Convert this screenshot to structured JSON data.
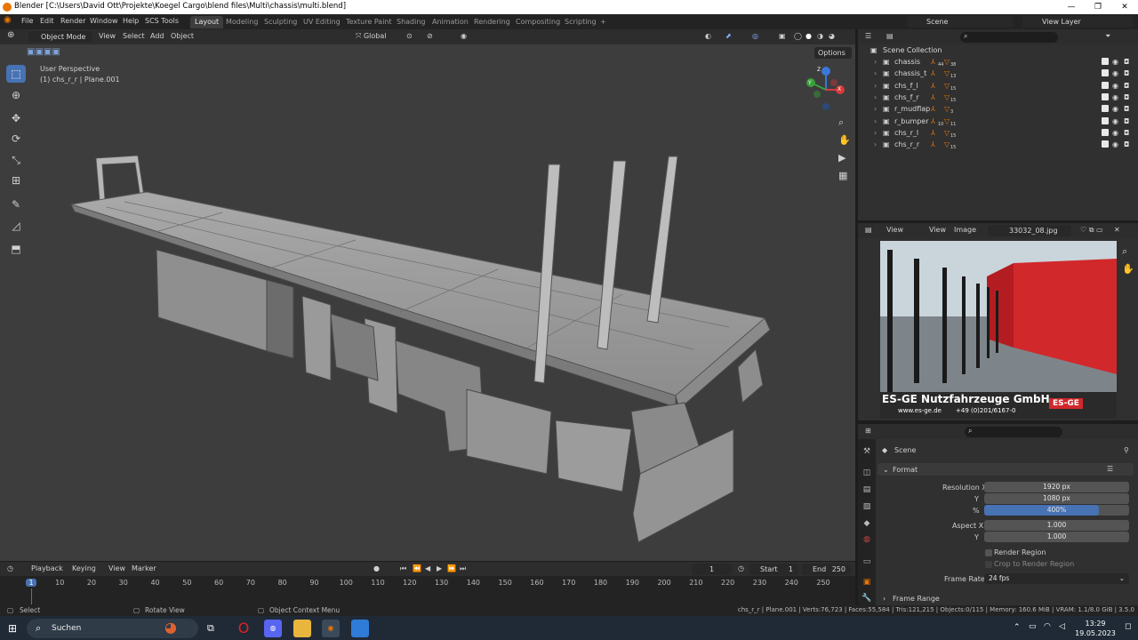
{
  "window": {
    "title": "Blender [C:\\Users\\David Ott\\Projekte\\Koegel Cargo\\blend files\\Multi\\chassis\\multi.blend]",
    "controls": [
      "—",
      "❐",
      "✕"
    ]
  },
  "menu": [
    "File",
    "Edit",
    "Render",
    "Window",
    "Help",
    "SCS Tools"
  ],
  "workspaces": [
    {
      "label": "Layout",
      "active": true
    },
    {
      "label": "Modeling"
    },
    {
      "label": "Sculpting"
    },
    {
      "label": "UV Editing"
    },
    {
      "label": "Texture Paint"
    },
    {
      "label": "Shading"
    },
    {
      "label": "Animation"
    },
    {
      "label": "Rendering"
    },
    {
      "label": "Compositing"
    },
    {
      "label": "Scripting"
    },
    {
      "label": "+"
    }
  ],
  "top_right": {
    "scene": "Scene",
    "view_layer": "View Layer"
  },
  "viewport": {
    "mode": "Object Mode",
    "menus": [
      "View",
      "Select",
      "Add",
      "Object"
    ],
    "orientation": "Global",
    "options": "Options",
    "info_line1": "User Perspective",
    "info_line2": "(1) chs_r_r | Plane.001",
    "gizmo": {
      "x": "X",
      "y": "Y",
      "z": "Z"
    }
  },
  "outliner": {
    "root": "Scene Collection",
    "items": [
      {
        "name": "chassis",
        "badges": [
          "44",
          "38"
        ]
      },
      {
        "name": "chassis_t",
        "badges": [
          "",
          "13"
        ]
      },
      {
        "name": "chs_f_l",
        "badges": [
          "",
          "15"
        ]
      },
      {
        "name": "chs_f_r",
        "badges": [
          "",
          "15"
        ]
      },
      {
        "name": "r_mudflap",
        "badges": [
          "",
          "3"
        ]
      },
      {
        "name": "r_bumper",
        "badges": [
          "10",
          "11"
        ]
      },
      {
        "name": "chs_r_l",
        "badges": [
          "",
          "15"
        ]
      },
      {
        "name": "chs_r_r",
        "badges": [
          "",
          "15"
        ]
      }
    ]
  },
  "image_editor": {
    "menus": [
      "View",
      "View",
      "Image"
    ],
    "image_name": "33032_08.jpg",
    "photo_text": {
      "company": "ES-GE Nutzfahrzeuge GmbH",
      "web": "www.es-ge.de",
      "phone": "+49 (0)201/6167-0",
      "logo": "ES-GE"
    }
  },
  "properties": {
    "context": "Scene",
    "section_format": "Format",
    "resolution_x_label": "Resolution X",
    "resolution_x": "1920 px",
    "y_label": "Y",
    "resolution_y": "1080 px",
    "percent_label": "%",
    "percent": "400%",
    "percent_fraction": 1.0,
    "aspect_x_label": "Aspect X",
    "aspect_x": "1.000",
    "aspect_y_label": "Y",
    "aspect_y": "1.000",
    "render_region": "Render Region",
    "crop_region": "Crop to Render Region",
    "frame_rate_label": "Frame Rate",
    "frame_rate": "24 fps",
    "section_frame_range": "Frame Range"
  },
  "timeline": {
    "menus": [
      "Playback",
      "Keying",
      "View",
      "Marker"
    ],
    "current_frame": "1",
    "start_label": "Start",
    "start": "1",
    "end_label": "End",
    "end": "250",
    "ticks": [
      "1",
      "10",
      "20",
      "30",
      "40",
      "50",
      "60",
      "70",
      "80",
      "90",
      "100",
      "110",
      "120",
      "130",
      "140",
      "150",
      "160",
      "170",
      "180",
      "190",
      "200",
      "210",
      "220",
      "230",
      "240",
      "250"
    ]
  },
  "status": {
    "select": "Select",
    "rotate": "Rotate View",
    "context_menu": "Object Context Menu",
    "stats": "chs_r_r | Plane.001 | Verts:76,723 | Faces:55,584 | Tris:121,215 | Objects:0/115 | Memory: 160.6 MiB | VRAM: 1.1/8.0 GiB | 3.5.0"
  },
  "taskbar": {
    "search": "Suchen",
    "time": "13:29",
    "date": "19.05.2023"
  },
  "colors": {
    "accent": "#4772b3",
    "orange": "#ea7600",
    "panel": "#303030",
    "viewport_bg": "#3d3d3d"
  }
}
